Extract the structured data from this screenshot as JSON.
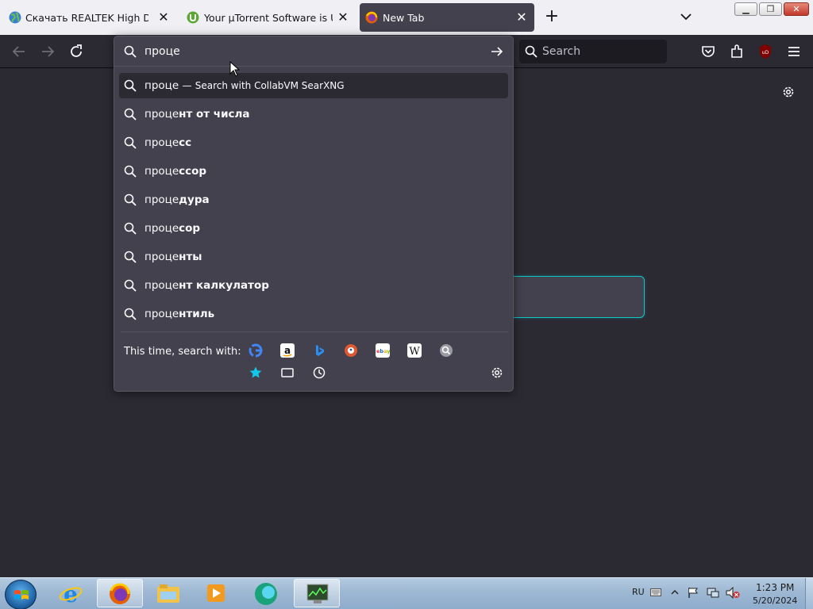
{
  "browser": {
    "tabs": [
      {
        "title": "Скачать REALTEK High Definiti",
        "active": false,
        "favicon": "globe-icon"
      },
      {
        "title": "Your µTorrent Software is Up to",
        "active": false,
        "favicon": "utorrent-icon"
      },
      {
        "title": "New Tab",
        "active": true,
        "favicon": "firefox-icon"
      }
    ],
    "searchbar_placeholder": "Search"
  },
  "urlbar": {
    "value": "проце",
    "heuristic": {
      "query": "проце",
      "separator": "—",
      "action": "Search with CollabVM SearXNG"
    },
    "suggestions": [
      {
        "typed": "проце",
        "rest": "нт от числа"
      },
      {
        "typed": "проце",
        "rest": "сс"
      },
      {
        "typed": "проце",
        "rest": "ссор"
      },
      {
        "typed": "проце",
        "rest": "дура"
      },
      {
        "typed": "проце",
        "rest": "сор"
      },
      {
        "typed": "проце",
        "rest": "нты"
      },
      {
        "typed": "проце",
        "rest": "нт калкулатор"
      },
      {
        "typed": "проце",
        "rest": "нтиль"
      }
    ],
    "one_off_label": "This time, search with:",
    "engines": [
      "google-icon",
      "amazon-icon",
      "bing-icon",
      "duckduckgo-icon",
      "ebay-icon",
      "wikipedia-icon",
      "searxng-icon",
      "bookmarks-icon",
      "tabs-icon",
      "history-icon"
    ]
  },
  "taskbar": {
    "language": "RU",
    "time": "1:23 PM",
    "date": "5/20/2024",
    "apps": [
      "ie-icon",
      "firefox-icon",
      "explorer-icon",
      "media-player-icon",
      "browser-app-icon",
      "task-manager-icon"
    ]
  },
  "colors": {
    "accent": "#0ec8c8",
    "panel": "#42414d",
    "background": "#2b2a33"
  }
}
